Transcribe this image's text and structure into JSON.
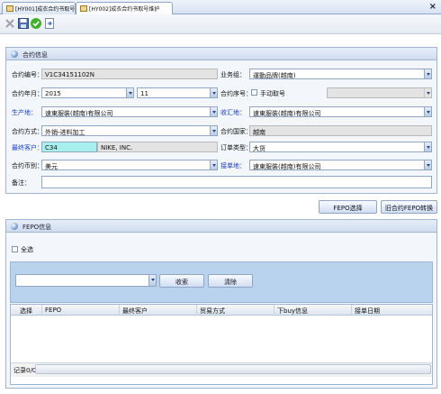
{
  "tabs": [
    {
      "label": "[HY001]成衣合约书取号",
      "active": false
    },
    {
      "label": "[HY002]成衣合约书取号维护",
      "active": true
    }
  ],
  "window": {
    "close": "×"
  },
  "toolbar": {
    "icons": [
      "cancel-icon",
      "save-icon",
      "confirm-icon",
      "export-icon"
    ]
  },
  "contract": {
    "title": "合约信息",
    "contract_no_label": "合约编号：",
    "contract_no": "V1C34151102N",
    "biz_group_label": "业务组：",
    "biz_group": "運動品牌(越南)",
    "contract_ym_label": "合约年月：",
    "year": "2015",
    "month": "11",
    "seq_label": "合约序号：",
    "manual_label": "手动取号",
    "producer_label": "生产地：",
    "producer": "速東服裝(越南)有限公司",
    "receiver_label": "收汇地：",
    "receiver": "速東服裝(越南)有限公司",
    "mode_label": "合约方式：",
    "mode": "外销-进料加工",
    "country_label": "合约国家：",
    "country": "越南",
    "customer_label": "最终客户：",
    "customer_code": "C34",
    "customer_name": "NIKE, INC.",
    "order_type_label": "订单类型：",
    "order_type": "大货",
    "currency_label": "合约币别：",
    "currency": "美元",
    "order_place_label": "接单地：",
    "order_place": "速東服裝(越南)有限公司",
    "remark_label": "备注：",
    "remark": ""
  },
  "actions": {
    "fepo_select": "FEPO选择",
    "old_fepo": "旧合约FEPO转换"
  },
  "fepo": {
    "title": "FEPO信息",
    "select_all": "全选",
    "search_value": "",
    "query_btn": "收索",
    "clear_btn": "清除",
    "columns": [
      "选择",
      "FEPO",
      "最终客户",
      "贸易方式",
      "下buy信息",
      "接单日期"
    ],
    "record_count": "记录0/0"
  },
  "colors": {
    "accent": "#1a3fc9",
    "readonly": "#e3e3e3",
    "highlight": "#a8f0ee",
    "header": "#cfdcef"
  }
}
